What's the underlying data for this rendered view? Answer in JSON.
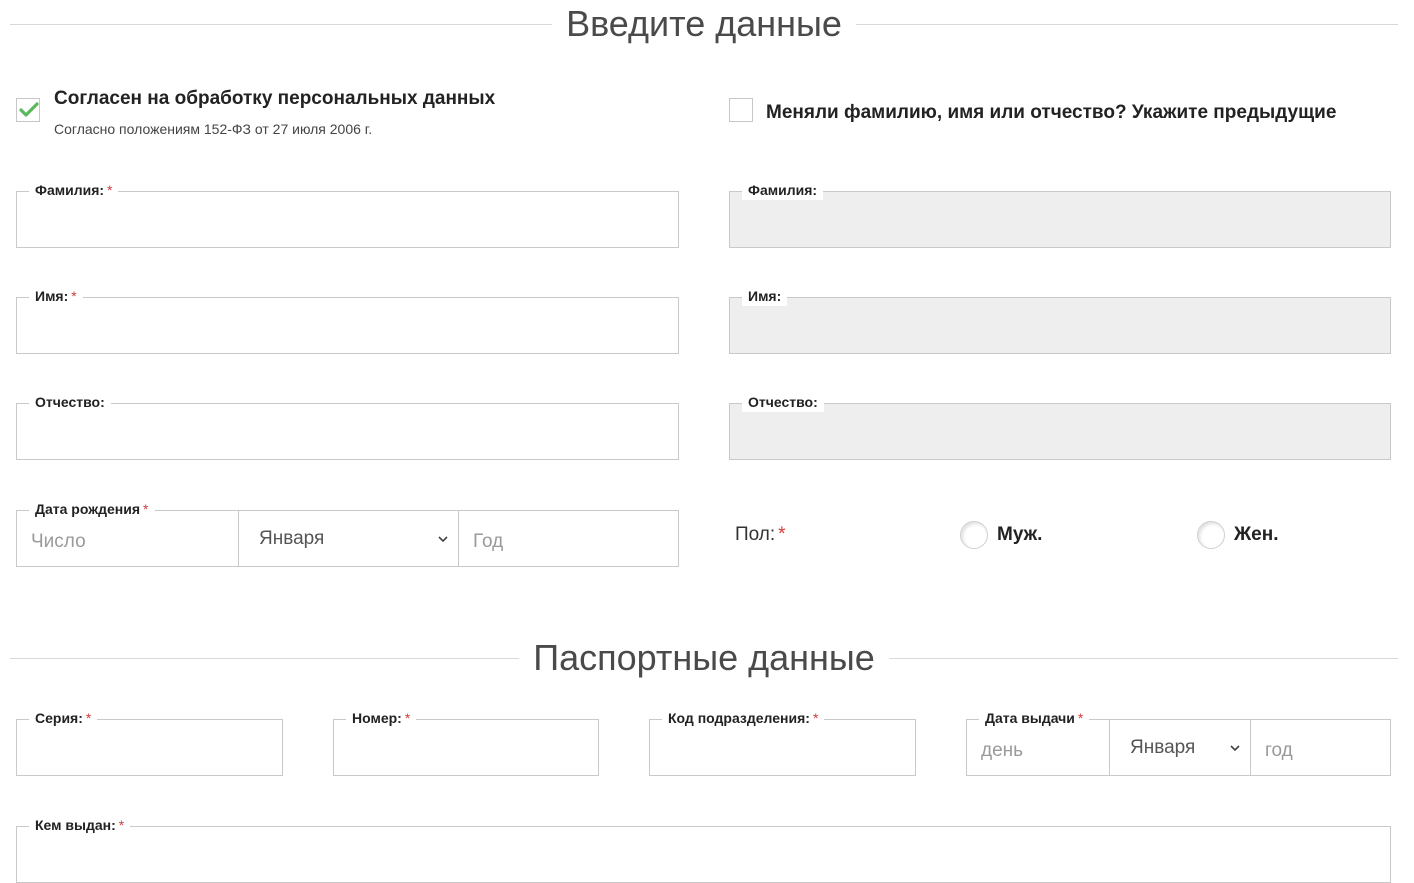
{
  "personal": {
    "heading": "Введите данные",
    "consent": {
      "title": "Согласен на обработку персональных данных",
      "subtitle": "Согласно положениям 152-ФЗ от 27 июля 2006 г.",
      "checked": true
    },
    "name_changed": {
      "title": "Меняли фамилию, имя или отчество? Укажите предыдущие",
      "checked": false
    },
    "surname": {
      "label": "Фамилия:",
      "required": "*",
      "value": ""
    },
    "first_name": {
      "label": "Имя:",
      "required": "*",
      "value": ""
    },
    "patronymic": {
      "label": "Отчество:",
      "value": ""
    },
    "prev_surname": {
      "label": "Фамилия:",
      "value": ""
    },
    "prev_first_name": {
      "label": "Имя:",
      "value": ""
    },
    "prev_patronymic": {
      "label": "Отчество:",
      "value": ""
    },
    "birth_date": {
      "label": "Дата рождения",
      "required": "*",
      "day_placeholder": "Число",
      "month_selected": "Января",
      "year_placeholder": "Год"
    },
    "gender": {
      "label": "Пол:",
      "required": "*",
      "male": "Муж.",
      "female": "Жен."
    }
  },
  "passport": {
    "heading": "Паспортные данные",
    "series": {
      "label": "Серия:",
      "required": "*",
      "value": ""
    },
    "number": {
      "label": "Номер:",
      "required": "*",
      "value": ""
    },
    "division_code": {
      "label": "Код подразделения:",
      "required": "*",
      "value": ""
    },
    "issue_date": {
      "label": "Дата выдачи",
      "required": "*",
      "day_placeholder": "день",
      "month_selected": "Января",
      "year_placeholder": "год"
    },
    "issued_by": {
      "label": "Кем выдан:",
      "required": "*",
      "value": ""
    }
  },
  "colors": {
    "check_green": "#5cb85c",
    "required_red": "#d23c3c",
    "disabled_bg": "#eeeeee",
    "border": "#c9c9c9"
  }
}
